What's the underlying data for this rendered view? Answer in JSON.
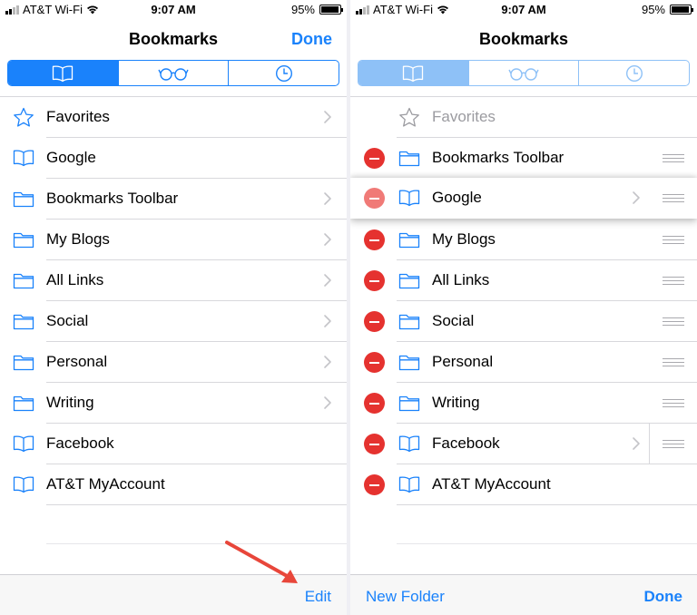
{
  "colors": {
    "accent": "#1a82fb",
    "delete": "#e5322f",
    "separator": "#d8d8dc",
    "arrow": "#e8463a"
  },
  "left": {
    "status": {
      "carrier": "AT&T Wi-Fi",
      "time": "9:07 AM",
      "battery": "95%"
    },
    "nav": {
      "title": "Bookmarks",
      "done": "Done"
    },
    "segments": [
      "bookmarks-icon",
      "reading-list-icon",
      "history-icon"
    ],
    "items": [
      {
        "label": "Favorites",
        "icon": "star-icon"
      },
      {
        "label": "Google",
        "icon": "book-icon"
      },
      {
        "label": "Bookmarks Toolbar",
        "icon": "folder-icon"
      },
      {
        "label": "My Blogs",
        "icon": "folder-icon"
      },
      {
        "label": "All Links",
        "icon": "folder-icon"
      },
      {
        "label": "Social",
        "icon": "folder-icon"
      },
      {
        "label": "Personal",
        "icon": "folder-icon"
      },
      {
        "label": "Writing",
        "icon": "folder-icon"
      },
      {
        "label": "Facebook",
        "icon": "book-icon"
      },
      {
        "label": "AT&T MyAccount",
        "icon": "book-icon"
      }
    ],
    "toolbar": {
      "edit": "Edit"
    }
  },
  "right": {
    "status": {
      "carrier": "AT&T Wi-Fi",
      "time": "9:07 AM",
      "battery": "95%"
    },
    "nav": {
      "title": "Bookmarks"
    },
    "items": [
      {
        "label": "Favorites",
        "icon": "star-icon"
      },
      {
        "label": "Bookmarks Toolbar",
        "icon": "folder-icon"
      },
      {
        "label": "Google",
        "icon": "book-icon"
      },
      {
        "label": "My Blogs",
        "icon": "folder-icon"
      },
      {
        "label": "All Links",
        "icon": "folder-icon"
      },
      {
        "label": "Social",
        "icon": "folder-icon"
      },
      {
        "label": "Personal",
        "icon": "folder-icon"
      },
      {
        "label": "Writing",
        "icon": "folder-icon"
      },
      {
        "label": "Facebook",
        "icon": "book-icon"
      },
      {
        "label": "AT&T MyAccount",
        "icon": "book-icon"
      }
    ],
    "toolbar": {
      "new_folder": "New Folder",
      "done": "Done"
    }
  }
}
